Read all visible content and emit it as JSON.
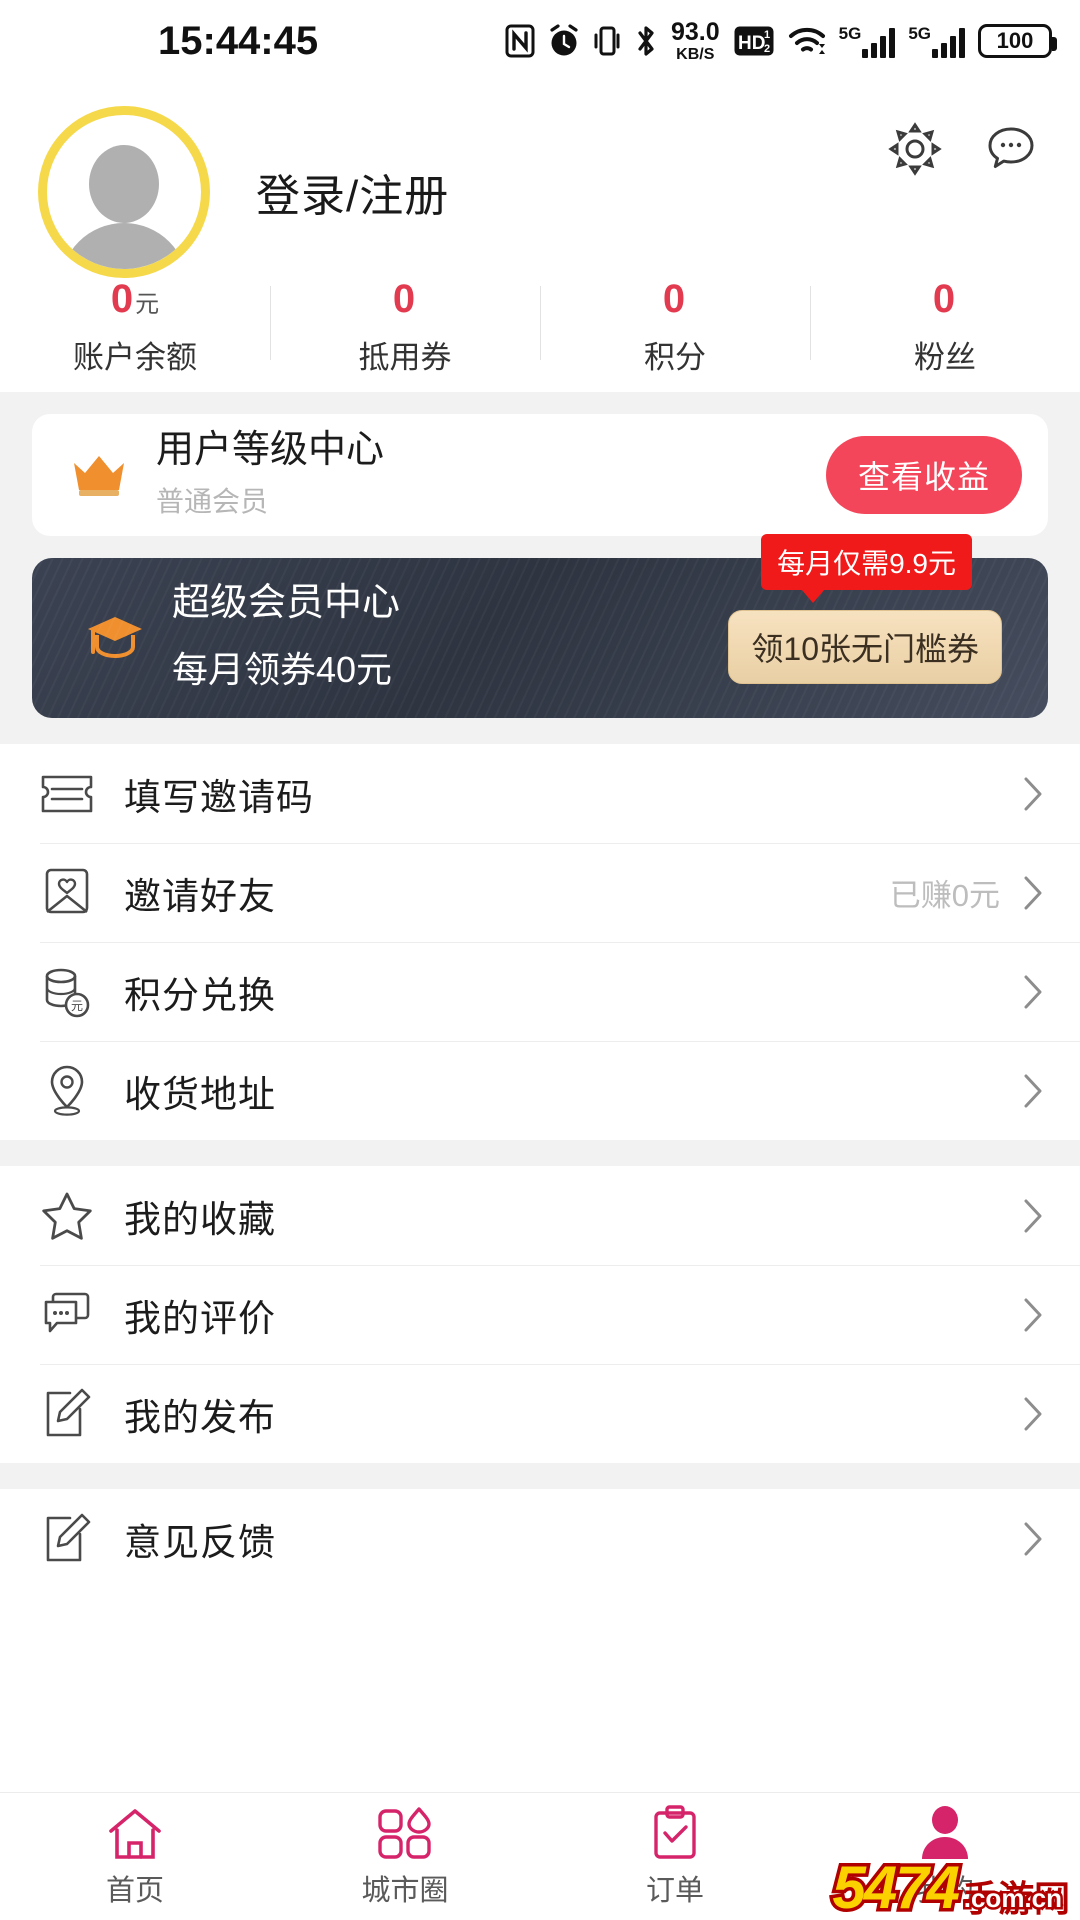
{
  "status_bar": {
    "time": "15:44:45",
    "net_speed_value": "93.0",
    "net_speed_unit": "KB/S",
    "hd_label": "HD",
    "sim1_label": "5G",
    "sim2_label": "5G",
    "battery": "100",
    "icons": [
      "nfc-icon",
      "alarm-icon",
      "vibrate-icon",
      "bluetooth-icon",
      "hd-icon",
      "wifi-icon",
      "signal-icon",
      "battery-icon"
    ]
  },
  "header": {
    "settings_icon": "gear-icon",
    "message_icon": "chat-bubble-icon",
    "login_label": "登录/注册",
    "avatar_icon": "default-avatar-icon"
  },
  "stats": [
    {
      "value": "0",
      "unit": "元",
      "label": "账户余额"
    },
    {
      "value": "0",
      "unit": "",
      "label": "抵用券"
    },
    {
      "value": "0",
      "unit": "",
      "label": "积分"
    },
    {
      "value": "0",
      "unit": "",
      "label": "粉丝"
    }
  ],
  "level_card": {
    "icon": "crown-icon",
    "title": "用户等级中心",
    "subtitle": "普通会员",
    "button_label": "查看收益"
  },
  "svip_card": {
    "icon": "graduation-cap-icon",
    "title": "超级会员中心",
    "subtitle": "每月领券40元",
    "price_badge": "每月仅需9.9元",
    "button_label": "领10张无门槛券"
  },
  "menu_group_1": [
    {
      "icon": "ticket-icon",
      "label": "填写邀请码",
      "extra": ""
    },
    {
      "icon": "envelope-heart-icon",
      "label": "邀请好友",
      "extra": "已赚0元"
    },
    {
      "icon": "coin-stack-icon",
      "label": "积分兑换",
      "extra": ""
    },
    {
      "icon": "location-pin-icon",
      "label": "收货地址",
      "extra": ""
    }
  ],
  "menu_group_2": [
    {
      "icon": "star-icon",
      "label": "我的收藏",
      "extra": ""
    },
    {
      "icon": "comment-icon",
      "label": "我的评价",
      "extra": ""
    },
    {
      "icon": "pencil-icon",
      "label": "我的发布",
      "extra": ""
    }
  ],
  "menu_group_3": [
    {
      "icon": "feedback-icon",
      "label": "意见反馈",
      "extra": ""
    }
  ],
  "tabbar": [
    {
      "icon": "home-icon",
      "label": "首页",
      "active": false
    },
    {
      "icon": "city-icon",
      "label": "城市圈",
      "active": false
    },
    {
      "icon": "order-icon",
      "label": "订单",
      "active": false
    },
    {
      "icon": "profile-icon",
      "label": "我的",
      "active": true
    }
  ],
  "watermark": {
    "main": "5474",
    "cn": "手游网",
    "domain": ".com.cn"
  },
  "colors": {
    "accent_red": "#e23a4e",
    "button_red": "#f4465a",
    "badge_red": "#f11a1a",
    "avatar_ring": "#f5d94b",
    "crown_orange": "#ee8b2a",
    "card_dark": "#2e3440",
    "coupon_gold": "#e9cfa4",
    "page_bg": "#f2f2f2",
    "tab_pink": "#d6246a"
  }
}
